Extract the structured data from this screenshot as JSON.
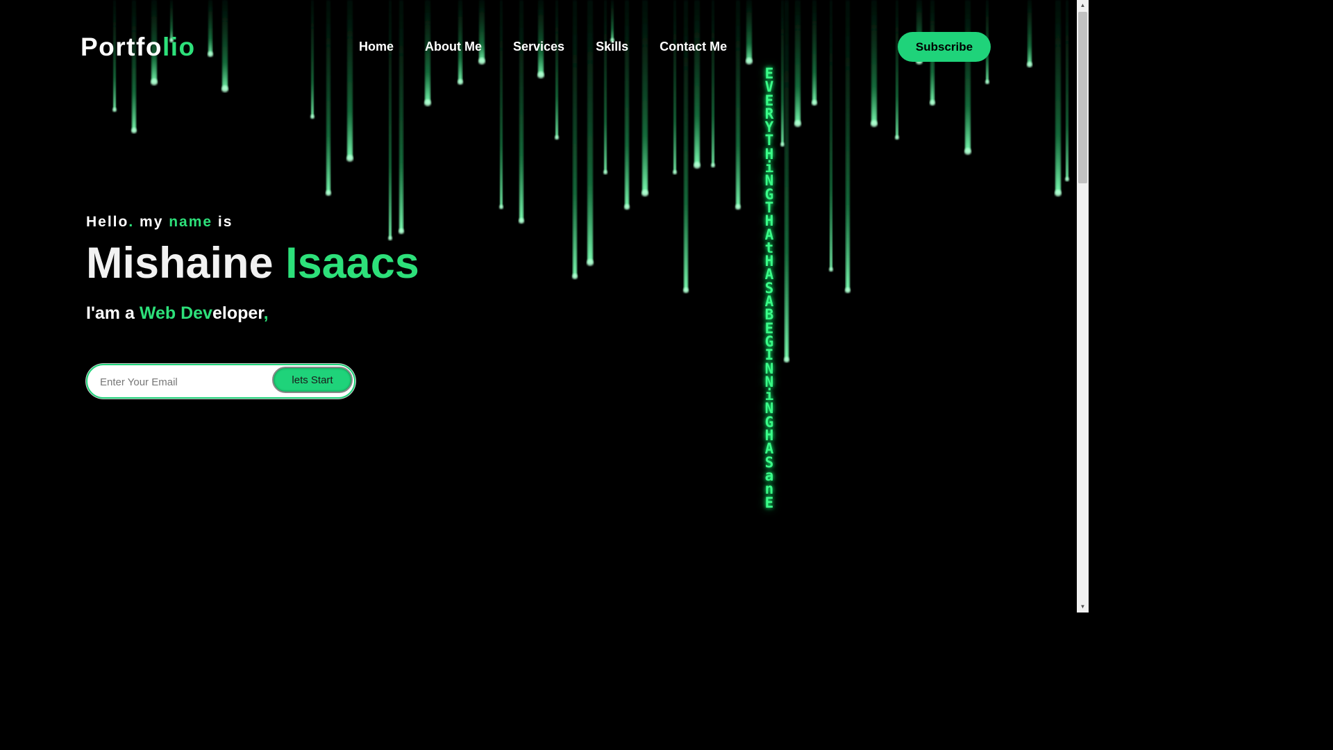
{
  "nav": {
    "logo_main": "Portfo",
    "logo_accent": "lio",
    "links": [
      "Home",
      "About Me",
      "Services",
      "Skills",
      "Contact Me"
    ],
    "subscribe_label": "Subscribe"
  },
  "hero": {
    "greeting": {
      "w1": "Hello",
      "dot": ".",
      "w2": " my ",
      "w3": "name",
      "w4": " is"
    },
    "name": {
      "first": "Mishaine ",
      "last": "Isaacs"
    },
    "role": {
      "prefix": "I'am a ",
      "green": "Web Dev",
      "white": "eloper",
      "comma": ","
    }
  },
  "email_form": {
    "placeholder": "Enter Your Email",
    "button_label": "lets Start"
  },
  "background": {
    "vertical_text": "EVERYTHiNG THAt HAS A BEGINNiNG HAS an E"
  },
  "colors": {
    "accent": "#2de07a",
    "button": "#1fd37a",
    "background": "#000000"
  }
}
